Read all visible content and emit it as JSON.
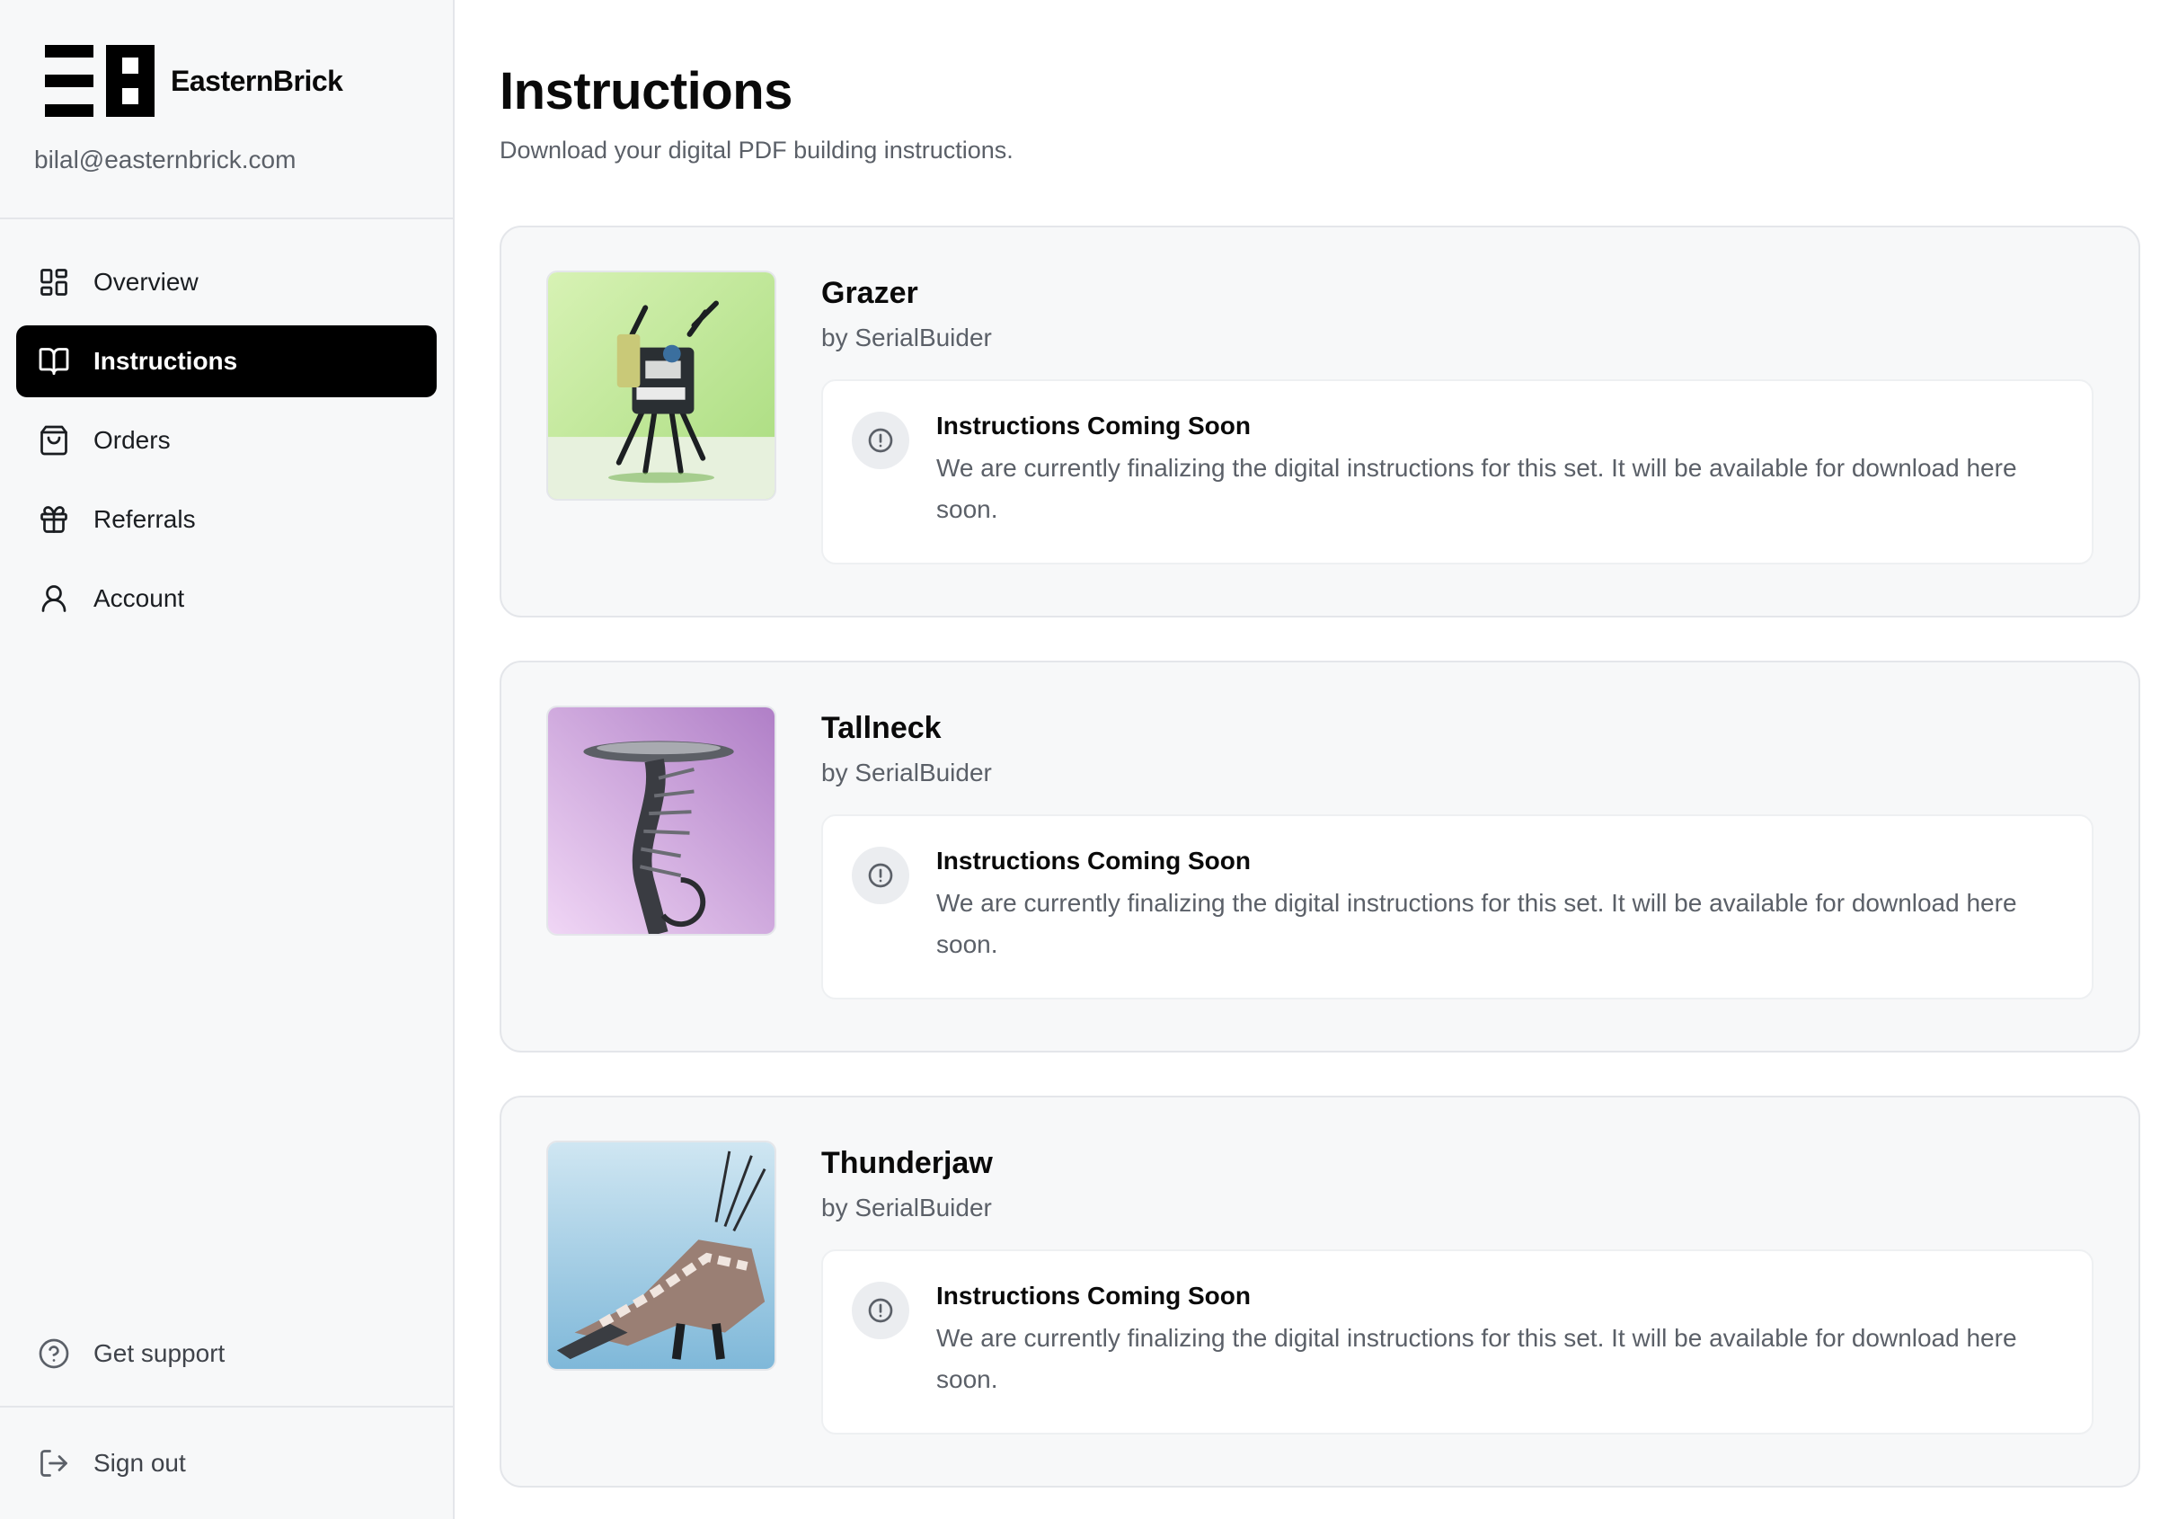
{
  "brand": {
    "name": "EasternBrick"
  },
  "user": {
    "email": "bilal@easternbrick.com"
  },
  "nav": [
    {
      "label": "Overview",
      "icon": "grid-icon",
      "active": false
    },
    {
      "label": "Instructions",
      "icon": "book-open-icon",
      "active": true
    },
    {
      "label": "Orders",
      "icon": "shopping-bag-icon",
      "active": false
    },
    {
      "label": "Referrals",
      "icon": "gift-icon",
      "active": false
    },
    {
      "label": "Account",
      "icon": "user-icon",
      "active": false
    }
  ],
  "footer_nav": {
    "support": {
      "label": "Get support",
      "icon": "help-circle-icon"
    },
    "signout": {
      "label": "Sign out",
      "icon": "log-out-icon"
    }
  },
  "page": {
    "title": "Instructions",
    "subtitle": "Download your digital PDF building instructions."
  },
  "sets": [
    {
      "name": "Grazer",
      "author": "by SerialBuider",
      "notice_title": "Instructions Coming Soon",
      "notice_desc": "We are currently finalizing the digital instructions for this set. It will be available for download here soon.",
      "bg_color": "#c5eaa0"
    },
    {
      "name": "Tallneck",
      "author": "by SerialBuider",
      "notice_title": "Instructions Coming Soon",
      "notice_desc": "We are currently finalizing the digital instructions for this set. It will be available for download here soon.",
      "bg_color": "#d7b3e6"
    },
    {
      "name": "Thunderjaw",
      "author": "by SerialBuider",
      "notice_title": "Instructions Coming Soon",
      "notice_desc": "We are currently finalizing the digital instructions for this set. It will be available for download here soon.",
      "bg_color": "#a9d2e8"
    }
  ]
}
